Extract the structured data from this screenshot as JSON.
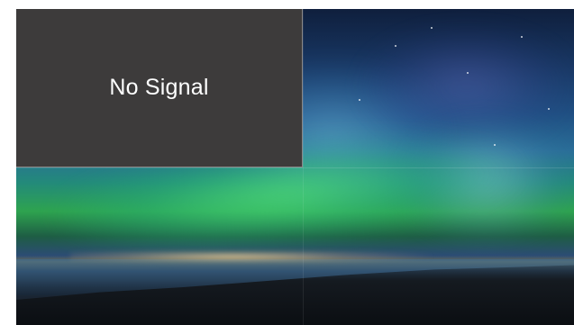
{
  "pip_window": {
    "status_text": "No Signal",
    "background_color": "#3d3b3b",
    "text_color": "#ffffff"
  },
  "main_display": {
    "content": "background-image-aurora-night-sky"
  }
}
